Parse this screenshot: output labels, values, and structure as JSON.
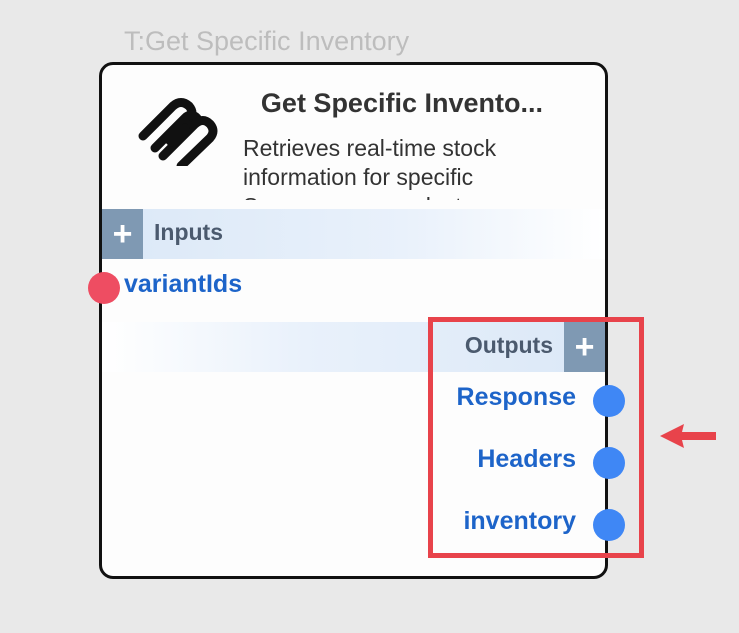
{
  "canvas": {
    "node_caption": "T:Get Specific Inventory"
  },
  "node": {
    "title": "Get Specific Invento...",
    "description": "Retrieves real-time stock information for specific Squarespace product",
    "logo_icon": "squarespace-logo-icon",
    "inputs": {
      "label": "Inputs",
      "add_label": "+",
      "ports": [
        {
          "label": "variantIds",
          "color": "#ee4d62"
        }
      ]
    },
    "outputs": {
      "label": "Outputs",
      "add_label": "+",
      "ports": [
        {
          "label": "Response",
          "color": "#3f87f5"
        },
        {
          "label": "Headers",
          "color": "#3f87f5"
        },
        {
          "label": "inventory",
          "color": "#3f87f5"
        }
      ]
    }
  },
  "annotations": {
    "highlight_color": "#e8434b",
    "arrow_icon": "left-arrow-icon"
  }
}
